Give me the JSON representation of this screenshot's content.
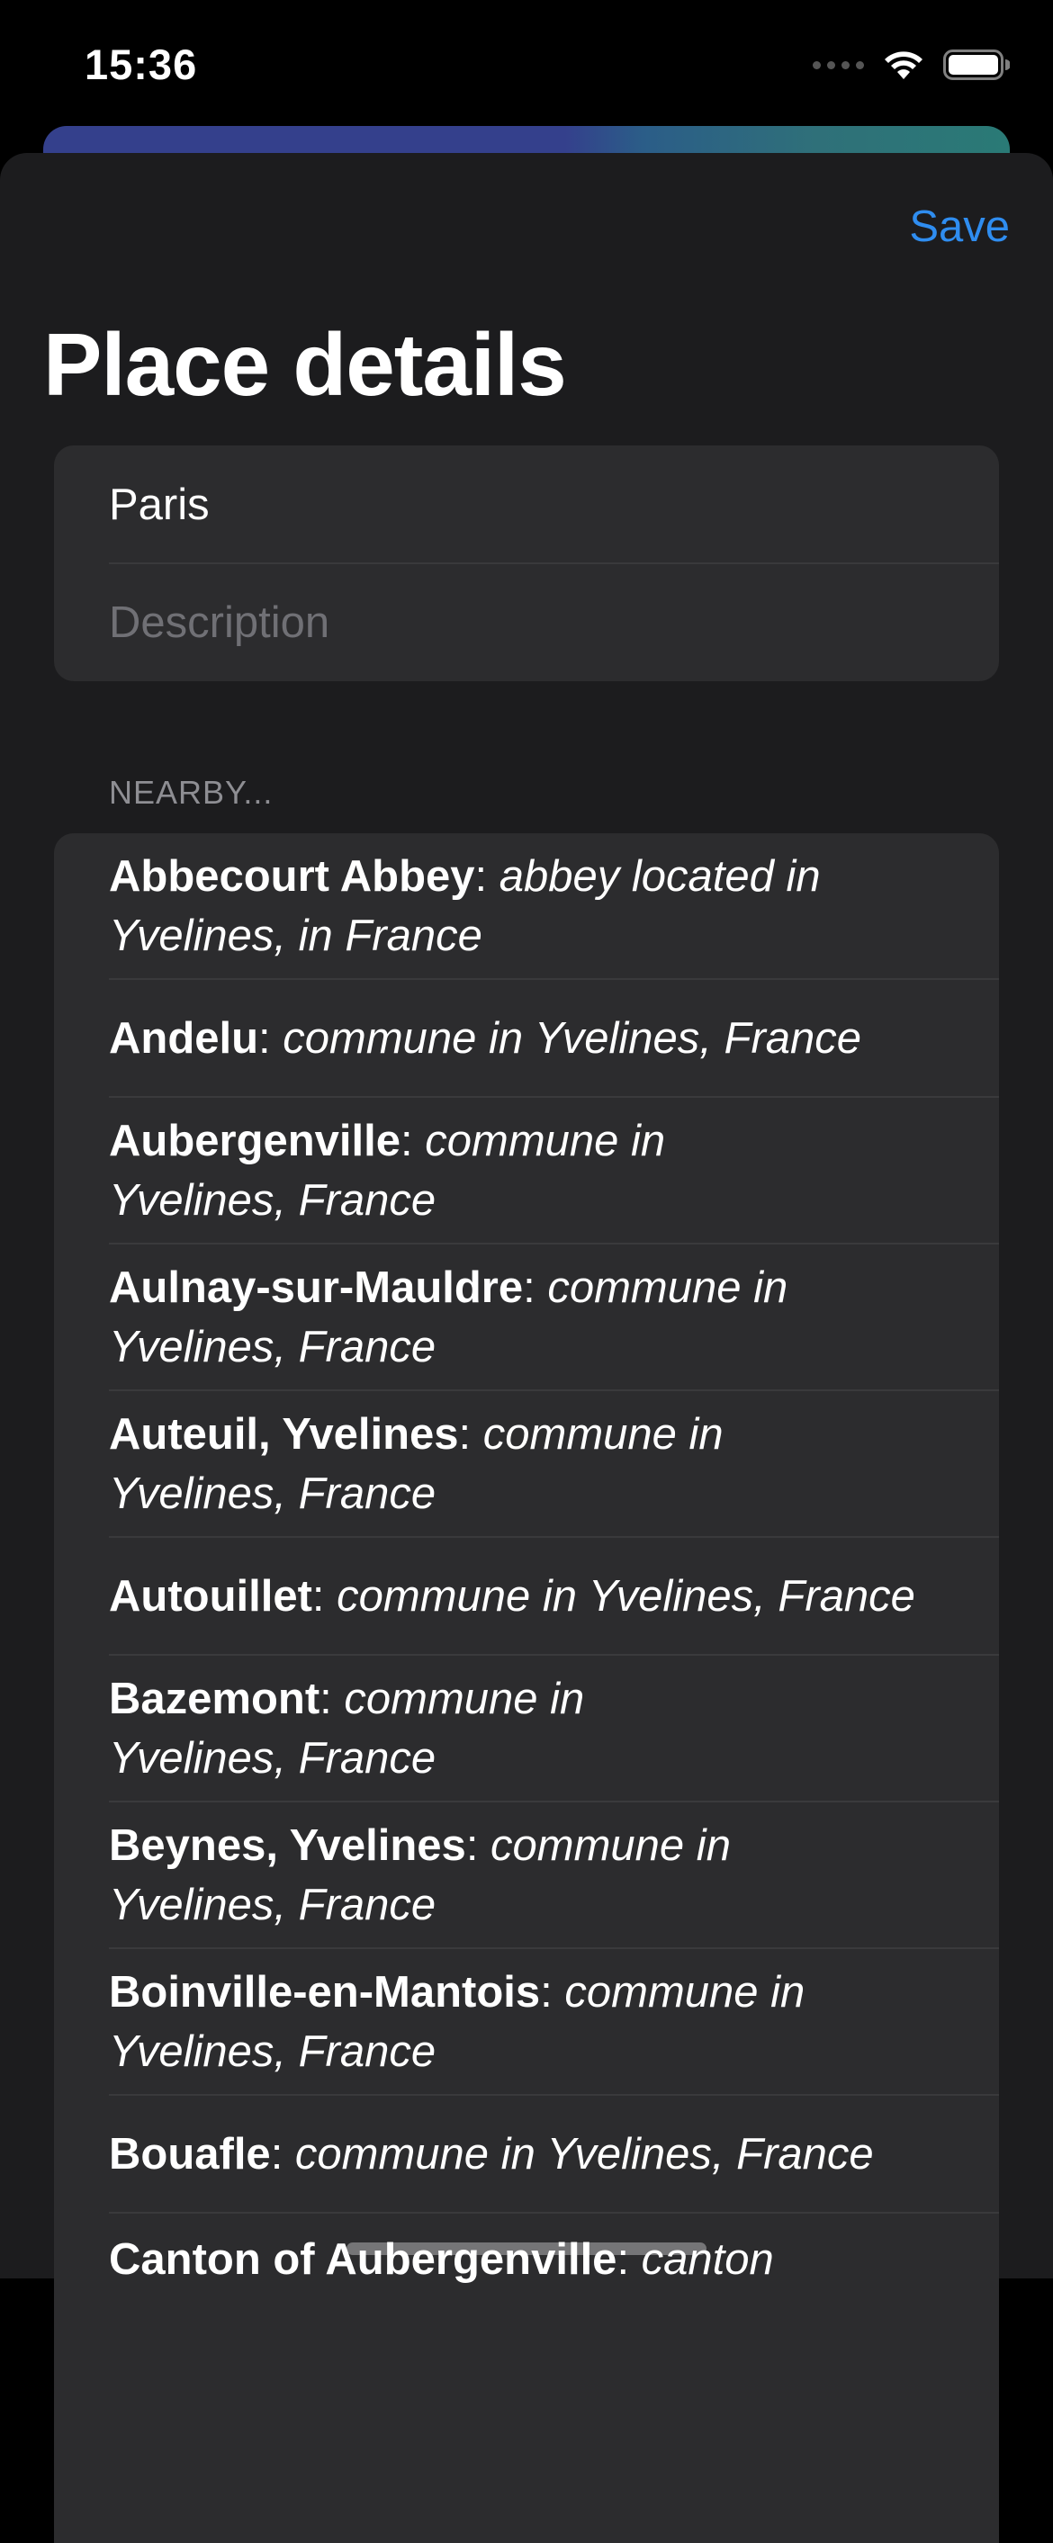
{
  "status_bar": {
    "time": "15:36"
  },
  "sheet": {
    "save_label": "Save",
    "title": "Place details",
    "name_value": "Paris",
    "description_placeholder": "Description"
  },
  "nearby": {
    "header": "NEARBY...",
    "items": [
      {
        "name": "Abbecourt Abbey",
        "desc": "abbey located in",
        "desc2": "Yvelines, in France"
      },
      {
        "name": "Andelu",
        "desc": "commune in Yvelines, France",
        "desc2": ""
      },
      {
        "name": "Aubergenville",
        "desc": "commune in",
        "desc2": "Yvelines, France"
      },
      {
        "name": "Aulnay-sur-Mauldre",
        "desc": "commune in",
        "desc2": "Yvelines, France"
      },
      {
        "name": "Auteuil, Yvelines",
        "desc": "commune in",
        "desc2": "Yvelines, France"
      },
      {
        "name": "Autouillet",
        "desc": "commune in Yvelines, France",
        "desc2": ""
      },
      {
        "name": "Bazemont",
        "desc": "commune in",
        "desc2": "Yvelines, France"
      },
      {
        "name": "Beynes, Yvelines",
        "desc": "commune in",
        "desc2": "Yvelines, France"
      },
      {
        "name": "Boinville-en-Mantois",
        "desc": "commune in",
        "desc2": "Yvelines, France"
      },
      {
        "name": "Bouafle",
        "desc": "commune in Yvelines, France",
        "desc2": ""
      },
      {
        "name": "Canton of Aubergenville",
        "desc": "canton",
        "desc2": ""
      }
    ]
  }
}
